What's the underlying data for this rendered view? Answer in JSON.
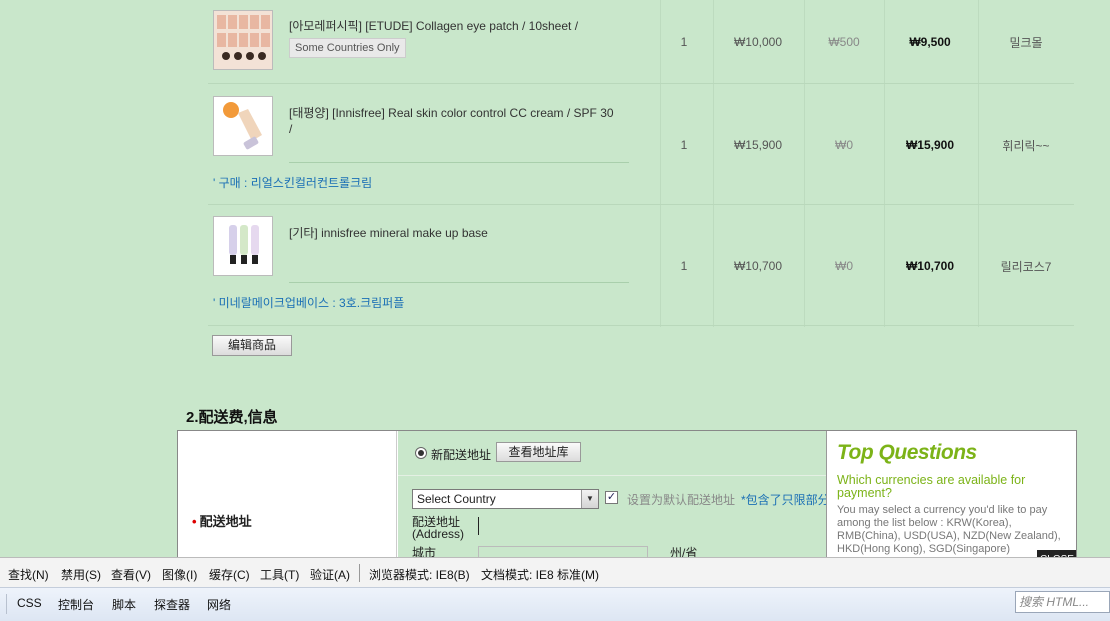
{
  "cart": {
    "items": [
      {
        "name": "[아모레퍼시픽] [ETUDE] Collagen eye patch / 10sheet /",
        "badge": "Some Countries Only",
        "option": "",
        "qty": "1",
        "price": "₩10,000",
        "discount": "₩500",
        "total": "₩9,500",
        "seller": "밀크몰"
      },
      {
        "name": "[태평양] [Innisfree] Real skin color control CC cream / SPF 30 /",
        "badge": "",
        "option": "' 구매 : 리얼스킨컬러컨트롤크림",
        "qty": "1",
        "price": "₩15,900",
        "discount": "₩0",
        "total": "₩15,900",
        "seller": "휘리릭~~"
      },
      {
        "name": "[기타] innisfree mineral make up base",
        "badge": "",
        "option": "' 미네랄메이크업베이스 : 3호.크림퍼플",
        "qty": "1",
        "price": "₩10,700",
        "discount": "₩0",
        "total": "₩10,700",
        "seller": "릴리코스7"
      }
    ],
    "edit_button": "编辑商品"
  },
  "shipping": {
    "section_title": "2.配送费,信息",
    "required_mark": "•",
    "label": "配送地址",
    "new_address_label": "新配送地址",
    "address_book_button": "查看地址库",
    "country_select": "Select Country",
    "default_address_label": "设置为默认配送地址",
    "tax_note": "*包含了只限部分国",
    "address_label_cn": "配送地址",
    "address_label_en": "(Address)",
    "city_label": "城市",
    "state_label": "州/省"
  },
  "faq": {
    "title": "Top Questions",
    "question": "Which currencies are available for payment?",
    "answer": "You may select a currency you'd like to pay among the list below : KRW(Korea), RMB(China), USD(USA), NZD(New Zealand), HKD(Hong Kong), SGD(Singapore)",
    "close": "CLOSE"
  },
  "devtools": {
    "menu": [
      "查找(N)",
      "禁用(S)",
      "查看(V)",
      "图像(I)",
      "缓存(C)",
      "工具(T)",
      "验证(A)",
      "浏览器模式: IE8(B)",
      "文档模式: IE8 标准(M)"
    ],
    "tabs": [
      "CSS",
      "控制台",
      "脚本",
      "探查器",
      "网络"
    ],
    "search_placeholder": "搜索 HTML..."
  },
  "colors": {
    "page_bg": "#c9e7cb",
    "link": "#1a6fb5",
    "faq_green": "#7cb318"
  }
}
